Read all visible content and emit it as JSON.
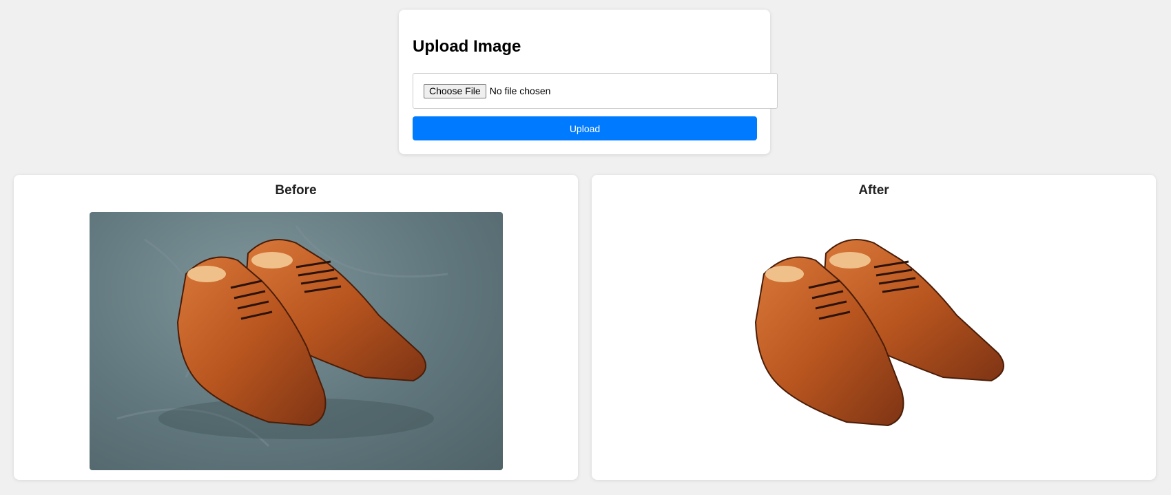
{
  "upload": {
    "title": "Upload Image",
    "choose_file_label": "Choose File",
    "no_file_text": "No file chosen",
    "upload_button_label": "Upload"
  },
  "panels": {
    "before_title": "Before",
    "after_title": "After"
  },
  "colors": {
    "page_background": "#f0f0f0",
    "card_background": "#ffffff",
    "upload_button": "#007bff",
    "photo_background": "#60777d",
    "shoe_leather": "#b8551f"
  }
}
